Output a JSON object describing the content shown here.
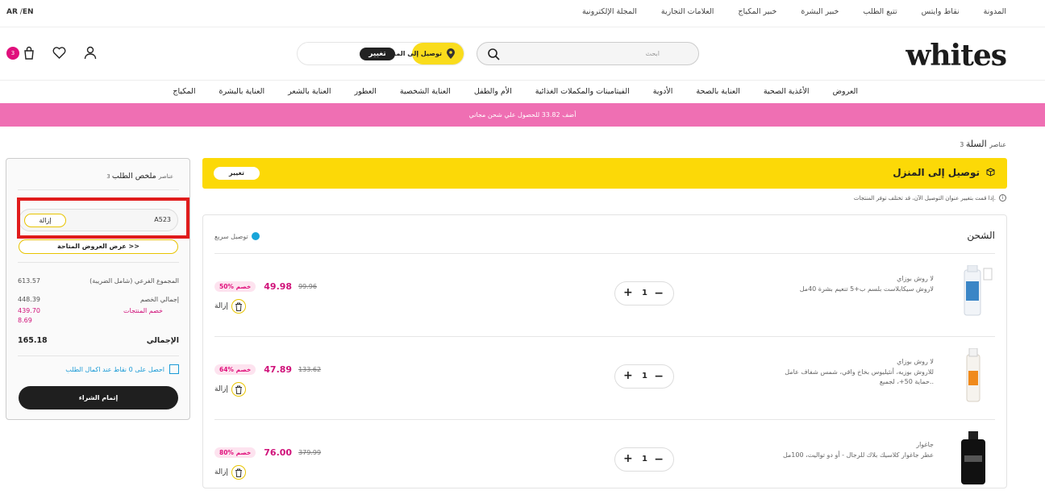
{
  "topbar": {
    "lang_ar": "AR",
    "lang_en": "EN",
    "links": [
      "المدونة",
      "نقاط وايتس",
      "تتبع الطلب",
      "خبير البشرة",
      "خبير المكياج",
      "العلامات التجارية",
      "المجلة الإلكترونية"
    ]
  },
  "header": {
    "logo": "whites",
    "search_placeholder": "ابحث",
    "delivery_label": "توصيل إلى المنزل",
    "delivery_change": "تغيير",
    "cart_count": "3"
  },
  "nav": {
    "items": [
      "العروض",
      "الأغذية الصحية",
      "العناية بالصحة",
      "الأدوية",
      "الفيتامينات والمكملات الغذائية",
      "الأم والطفل",
      "العناية الشخصية",
      "العطور",
      "العناية بالشعر",
      "العناية بالبشرة",
      "المكياج"
    ]
  },
  "promo": "أضف 33.82 للحصول علي شحن مجاني",
  "cart": {
    "title": "السلة",
    "count": "3 عناصر",
    "home_delivery": "توصيل إلى المنزل",
    "home_change": "تغيير",
    "note": "إذا قمت بتغيير عنوان التوصيل الآن، قد تختلف توفر المنتجات."
  },
  "shipping": {
    "title": "الشحن",
    "fast_label": "توصيل سريع",
    "items": [
      {
        "brand": "لا روش بوزاي",
        "name": "لاروش سيكابلاست بلسم ب+5 تنعيم بشرة 40مل",
        "qty": "1",
        "new_price": "49.98",
        "old_price": "99.96",
        "discount": "50% خصم",
        "remove": "إزالة"
      },
      {
        "brand": "لا روش بوزاي",
        "name": "للاروش بوزيه، أنثيليوس بخاخ واقي، شمس شفاف عامل حماية 50+، لجميع..",
        "qty": "1",
        "new_price": "47.89",
        "old_price": "133.62",
        "discount": "64% خصم",
        "remove": "إزالة"
      },
      {
        "brand": "جاغوار",
        "name": "عطر جاغوار كلاسيك بلاك للرجال - أو دو تواليت، 100مل",
        "qty": "1",
        "new_price": "76.00",
        "old_price": "379.99",
        "discount": "80% خصم",
        "remove": "إزالة"
      }
    ]
  },
  "summary": {
    "title": "ملخص الطلب",
    "count": "3 عناصر",
    "coupon_code": "A523",
    "coupon_remove": "إزالة",
    "offers_btn": "عرض العروض المتاحة >>",
    "subtotal_label": "المجموع الفرعي (شامل الضريبة)",
    "subtotal_value": "613.57",
    "discount_total_label": "إجمالي الخصم",
    "discount_total_value": "448.39",
    "product_discount_label": "خصم المنتجات",
    "product_discount_value": "439.70",
    "extra_discount_value": "8.69",
    "total_label": "الإجمالي",
    "total_value": "165.18",
    "points_text": "احصل على 0 نقاط عند اكمال الطلب",
    "checkout_btn": "إتمام الشراء"
  },
  "colors": {
    "brand_yellow": "#fcd907",
    "brand_pink": "#d0127a",
    "promo_bg": "#ef6fb3",
    "highlight_red": "#e01b1b"
  }
}
